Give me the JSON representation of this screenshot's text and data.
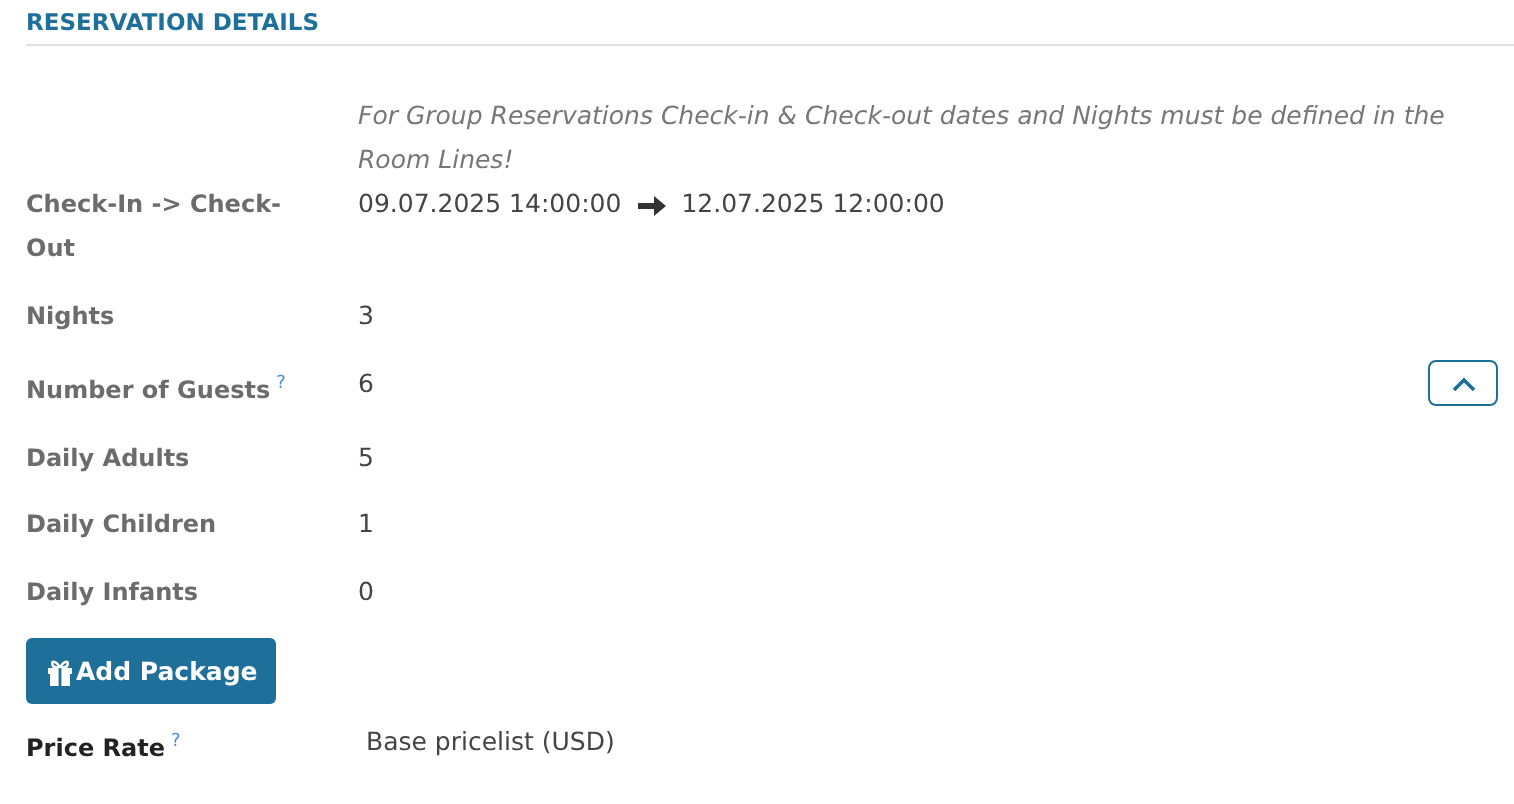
{
  "section_title": "RESERVATION DETAILS",
  "note": "For Group Reservations Check-in & Check-out dates and Nights must be defined in the Room Lines!",
  "dates": {
    "label": "Check-In -> Check-Out",
    "start": "09.07.2025 14:00:00",
    "end": "12.07.2025 12:00:00"
  },
  "fields": [
    {
      "label": "Nights",
      "value": "3"
    },
    {
      "label": "Number of Guests",
      "value": "6",
      "help_mark": "?"
    },
    {
      "label": "Daily Adults",
      "value": "5"
    },
    {
      "label": "Daily Children",
      "value": "1"
    },
    {
      "label": "Daily Infants",
      "value": "0"
    }
  ],
  "guests_toggle": {
    "expanded": true
  },
  "add_package_button": "Add Package",
  "price_rate": {
    "label": "Price Rate",
    "help_mark": "?",
    "value": "Base pricelist (USD)"
  }
}
